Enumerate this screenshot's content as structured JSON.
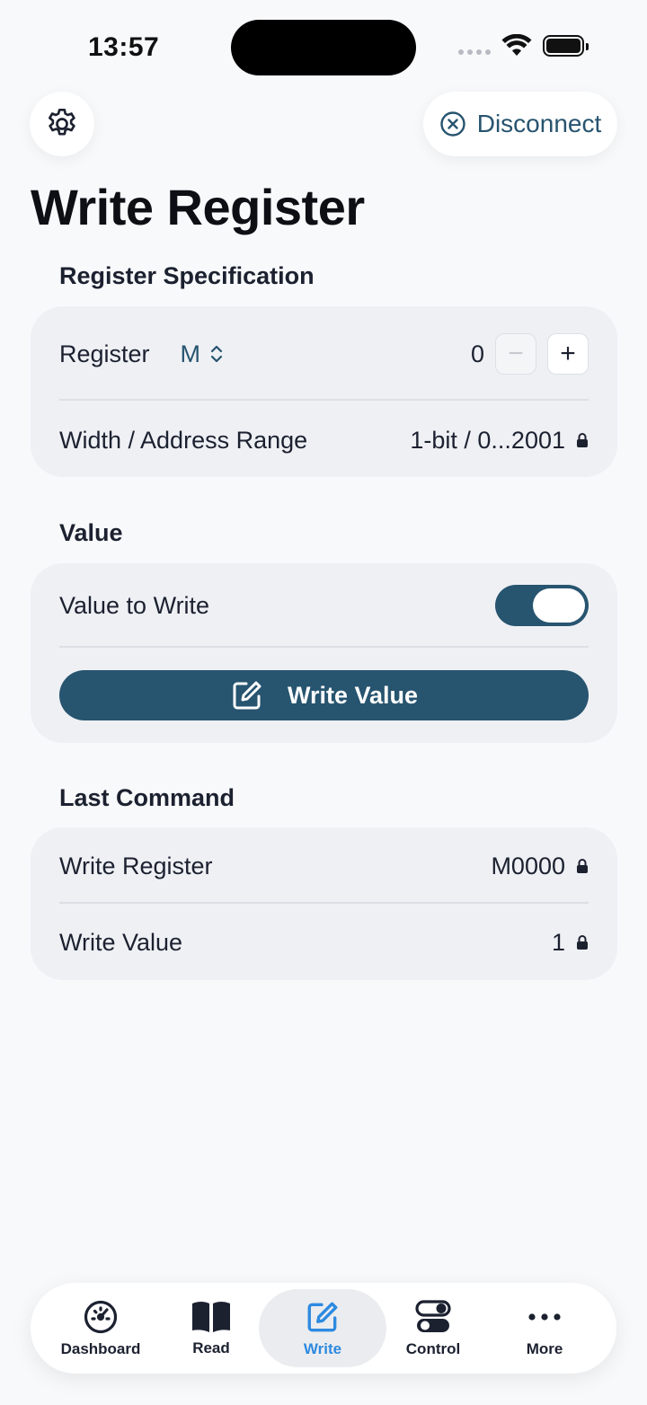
{
  "status": {
    "time": "13:57"
  },
  "header": {
    "disconnect_label": "Disconnect",
    "title": "Write Register"
  },
  "register_spec": {
    "section_title": "Register Specification",
    "register_label": "Register",
    "register_type": "M",
    "address": "0",
    "width_label": "Width / Address Range",
    "width_value": "1-bit / 0...2001"
  },
  "value": {
    "section_title": "Value",
    "value_label": "Value to Write",
    "toggle_on": true,
    "write_button": "Write Value"
  },
  "last_command": {
    "section_title": "Last Command",
    "register_label": "Write Register",
    "register_value": "M0000",
    "value_label": "Write Value",
    "value_value": "1"
  },
  "tabs": [
    {
      "label": "Dashboard",
      "icon": "gauge-icon",
      "active": false
    },
    {
      "label": "Read",
      "icon": "book-icon",
      "active": false
    },
    {
      "label": "Write",
      "icon": "edit-icon",
      "active": true
    },
    {
      "label": "Control",
      "icon": "toggles-icon",
      "active": false
    },
    {
      "label": "More",
      "icon": "ellipsis-icon",
      "active": false
    }
  ],
  "colors": {
    "accent": "#27546f",
    "tab_active": "#2d8ae0",
    "background": "#f8f9fb",
    "card": "#eef0f4"
  }
}
